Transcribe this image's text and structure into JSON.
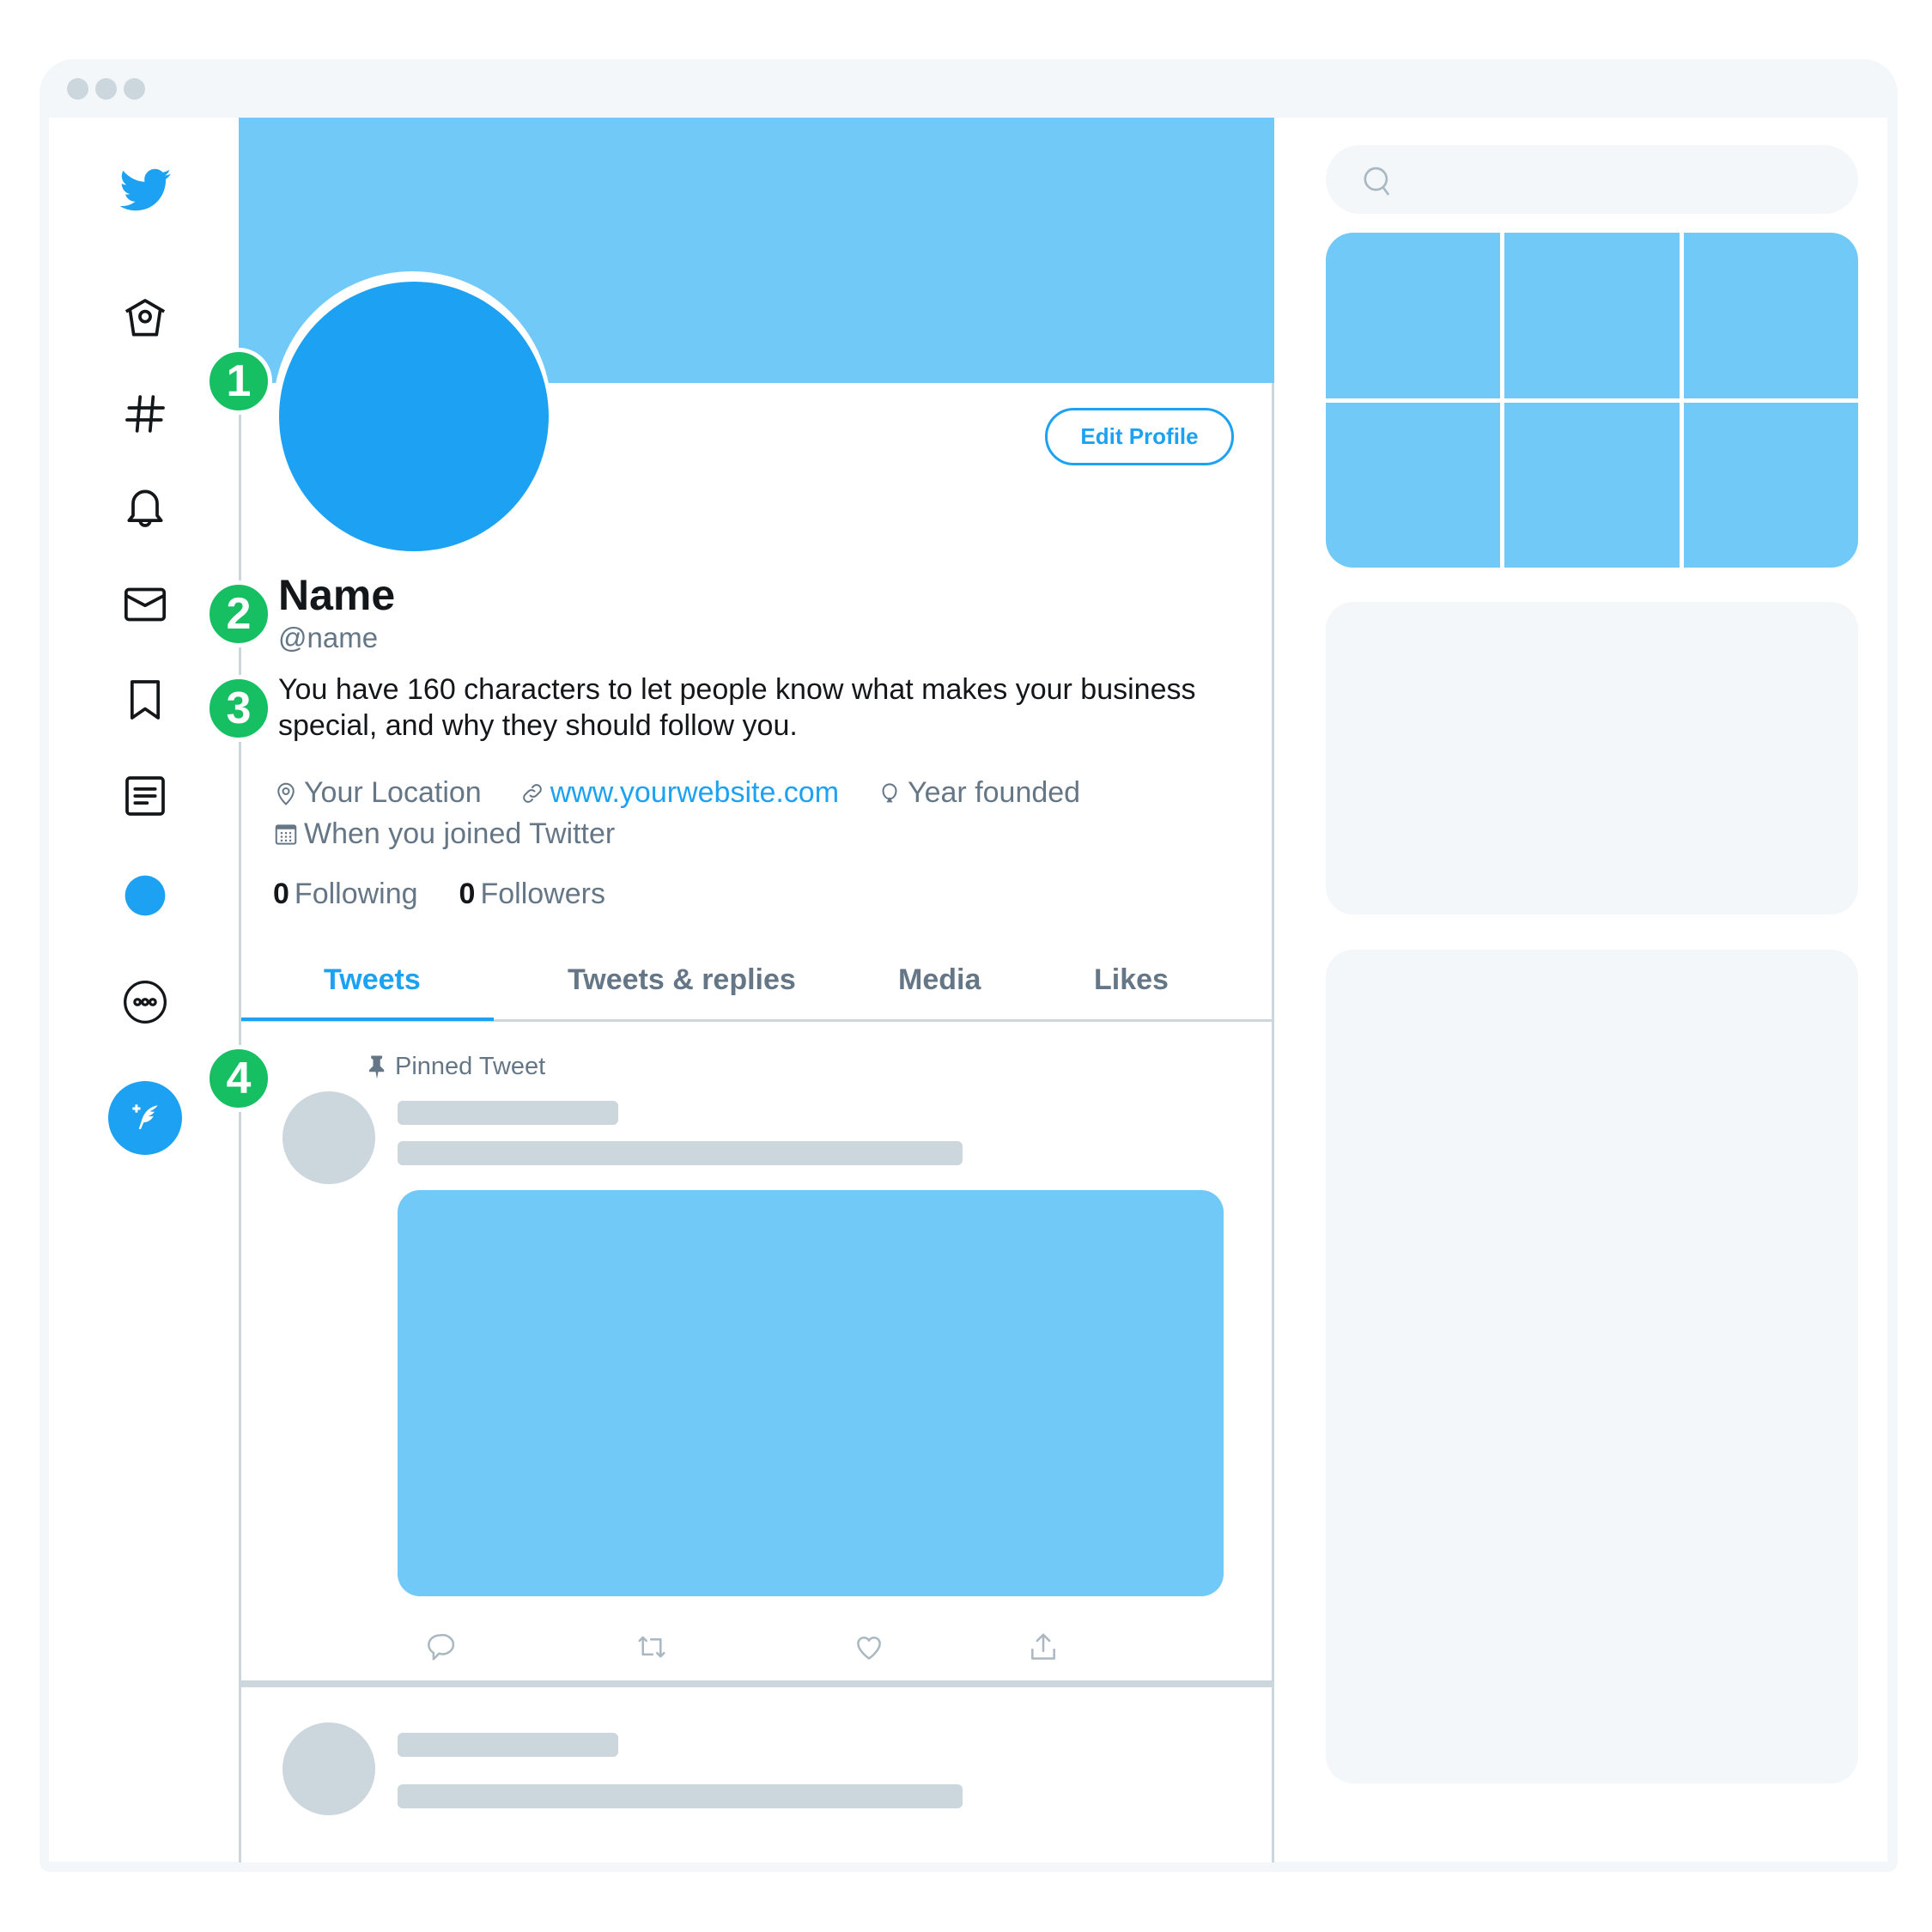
{
  "window": {
    "controls": [
      "close",
      "minimize",
      "maximize"
    ]
  },
  "colors": {
    "brand": "#1da1f2",
    "banner": "#71c9f8",
    "badge": "#17bf63",
    "secondary_text": "#657786",
    "placeholder": "#ccd6dd"
  },
  "sidebar": {
    "logo": "twitter-bird-icon",
    "items": [
      {
        "icon": "home-icon",
        "label": "Home"
      },
      {
        "icon": "hashtag-icon",
        "label": "Explore"
      },
      {
        "icon": "bell-icon",
        "label": "Notifications"
      },
      {
        "icon": "mail-icon",
        "label": "Messages"
      },
      {
        "icon": "bookmark-icon",
        "label": "Bookmarks"
      },
      {
        "icon": "list-icon",
        "label": "Lists"
      },
      {
        "icon": "profile-avatar-icon",
        "label": "Profile"
      },
      {
        "icon": "more-icon",
        "label": "More"
      }
    ],
    "compose": {
      "icon": "compose-tweet-icon",
      "label": "Tweet"
    }
  },
  "profile": {
    "edit_button": "Edit Profile",
    "name": "Name",
    "handle": "@name",
    "bio": "You have 160 characters to let people know what makes your business special, and why they should follow you.",
    "location": "Your Location",
    "website": "www.yourwebsite.com",
    "founded": "Year founded",
    "joined": "When you joined Twitter",
    "following_count": "0",
    "following_label": "Following",
    "followers_count": "0",
    "followers_label": "Followers"
  },
  "badges": [
    "1",
    "2",
    "3",
    "4"
  ],
  "tabs": [
    {
      "label": "Tweets",
      "active": true
    },
    {
      "label": "Tweets & replies",
      "active": false
    },
    {
      "label": "Media",
      "active": false
    },
    {
      "label": "Likes",
      "active": false
    }
  ],
  "pinned_label": "Pinned Tweet",
  "tweet_actions": [
    "reply-icon",
    "retweet-icon",
    "like-icon",
    "share-icon"
  ],
  "search": {
    "placeholder": ""
  }
}
